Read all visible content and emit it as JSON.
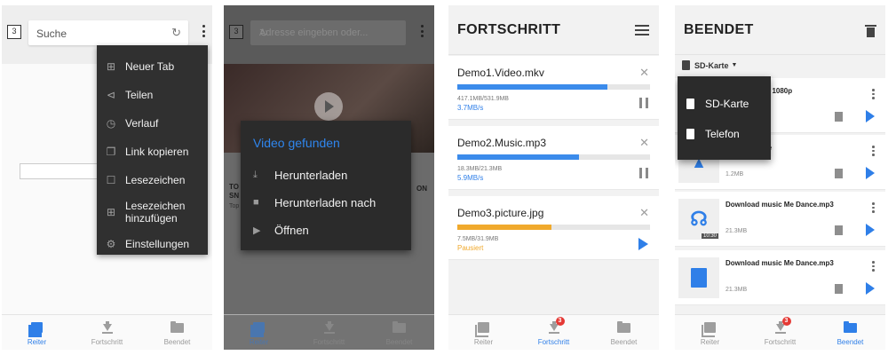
{
  "nav": {
    "tabs": "Reiter",
    "progress": "Fortschritt",
    "finished": "Beendet",
    "badge_count": "3"
  },
  "panel1": {
    "tab_count": "3",
    "search_placeholder": "Suche",
    "menu": [
      {
        "label": "Neuer Tab",
        "icon": "new-tab-icon"
      },
      {
        "label": "Teilen",
        "icon": "share-icon"
      },
      {
        "label": "Verlauf",
        "icon": "history-icon"
      },
      {
        "label": "Link kopieren",
        "icon": "copy-icon"
      },
      {
        "label": "Lesezeichen",
        "icon": "bookmark-icon"
      },
      {
        "label": "Lesezeichen hinzufügen",
        "icon": "bookmark-add-icon"
      },
      {
        "label": "Einstellungen",
        "icon": "gear-icon"
      }
    ]
  },
  "panel2": {
    "tab_count": "3",
    "address_placeholder": "Adresse eingeben oder...",
    "page_text_1": "TO",
    "page_text_2": "SN",
    "page_text_3": "Top",
    "page_text_4": "ON",
    "dialog": {
      "title": "Video gefunden",
      "options": [
        "Herunterladen",
        "Herunterladen nach",
        "Öffnen"
      ]
    }
  },
  "panel3": {
    "title": "FORTSCHRITT",
    "downloads": [
      {
        "name": "Demo1.Video.mkv",
        "size": "417.1MB/531.9MB",
        "status": "3.7MB/s",
        "progress": 0.78,
        "color": "#3b8beb",
        "state": "running"
      },
      {
        "name": "Demo2.Music.mp3",
        "size": "18.3MB/21.3MB",
        "status": "5.9MB/s",
        "progress": 0.63,
        "color": "#3b8beb",
        "state": "running"
      },
      {
        "name": "Demo3.picture.jpg",
        "size": "7.5MB/31.9MB",
        "status": "Pausiert",
        "progress": 0.49,
        "color": "#f0a92c",
        "state": "paused"
      }
    ]
  },
  "panel4": {
    "title": "BEENDET",
    "storage": "SD-Karte",
    "storage_options": [
      "SD-Karte",
      "Telefon"
    ],
    "files": [
      {
        "title": "nloads Ridge 1080p",
        "title2": "tv",
        "size": ""
      },
      {
        "title": "cture I am the",
        "title2": "",
        "size": "1.2MB"
      },
      {
        "title": "Download music Me Dance.mp3",
        "title2": "",
        "size": "21.3MB",
        "duration": "10:30"
      },
      {
        "title": "Download music Me Dance.mp3",
        "title2": "",
        "size": "21.3MB"
      }
    ]
  }
}
